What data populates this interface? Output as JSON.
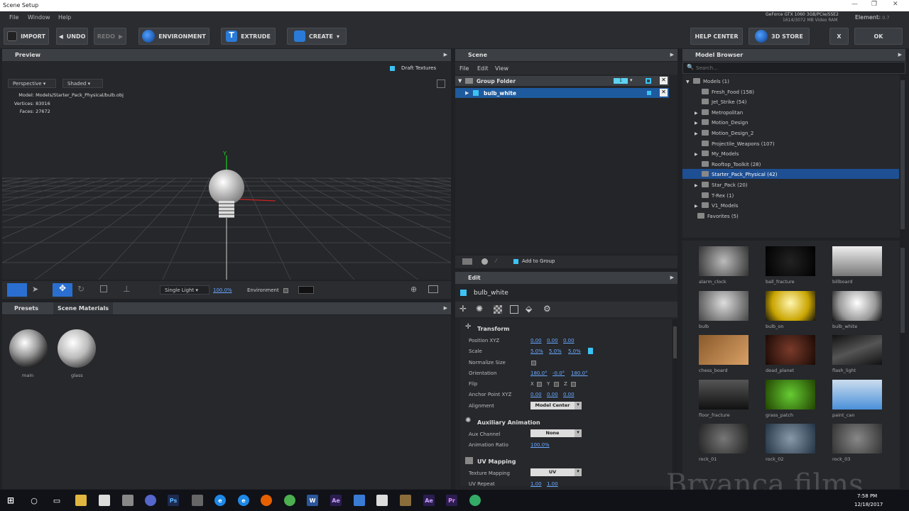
{
  "window": {
    "title": "Scene Setup",
    "app_name": "Element",
    "version": "2.0.7"
  },
  "menu": [
    "File",
    "Window",
    "Help"
  ],
  "gpu": {
    "line1": "GeForce GTX 1060 3GB/PCIe/SSE2",
    "line2": "1614/3072 MB Video RAM"
  },
  "toolbar": {
    "import": "IMPORT",
    "undo": "UNDO",
    "redo": "REDO",
    "environment": "ENVIRONMENT",
    "extrude": "EXTRUDE",
    "create": "CREATE",
    "help_center": "HELP CENTER",
    "store": "3D STORE",
    "x": "X",
    "ok": "OK"
  },
  "preview": {
    "title": "Preview",
    "draft_textures": "Draft Textures",
    "camera": "Perspective",
    "shading": "Shaded",
    "model_label": "Model:",
    "model": "Models/Starter_Pack_Physical/bulb.obj",
    "vertices_label": "Vertices:",
    "vertices": "83016",
    "faces_label": "Faces:",
    "faces": "27672",
    "axis_y": "Y"
  },
  "viewport_tools": {
    "light": "Single Light",
    "light_pct": "100.0%",
    "environment": "Environment"
  },
  "materials": {
    "tabs": [
      "Presets",
      "Scene Materials"
    ],
    "items": [
      "main",
      "glass"
    ]
  },
  "scene": {
    "title": "Scene",
    "menu": [
      "File",
      "Edit",
      "View"
    ],
    "group": "Group Folder",
    "group_badge": "1",
    "item": "bulb_white",
    "add_to_group": "Add to Group"
  },
  "edit": {
    "title": "Edit",
    "object": "bulb_white",
    "transform": {
      "title": "Transform",
      "position_label": "Position XYZ",
      "position": [
        "0.00",
        "0.00",
        "0.00"
      ],
      "scale_label": "Scale",
      "scale": [
        "5.0%",
        "5.0%",
        "5.0%"
      ],
      "normalize_label": "Normalize Size",
      "orientation_label": "Orientation",
      "orientation": [
        "180.0°",
        "-0.0°",
        "180.0°"
      ],
      "flip_label": "Flip",
      "flip": [
        "X",
        "Y",
        "Z"
      ],
      "anchor_label": "Anchor Point XYZ",
      "anchor": [
        "0.00",
        "0.00",
        "0.00"
      ],
      "alignment_label": "Alignment",
      "alignment": "Model Center"
    },
    "aux": {
      "title": "Auxiliary Animation",
      "channel_label": "Aux Channel",
      "channel": "None",
      "ratio_label": "Animation Ratio",
      "ratio": "100.0%"
    },
    "uv": {
      "title": "UV Mapping",
      "mapping_label": "Texture Mapping",
      "mapping": "UV",
      "repeat_label": "UV Repeat",
      "repeat": [
        "1.00",
        "1.00"
      ]
    }
  },
  "browser": {
    "title": "Model Browser",
    "search_placeholder": "Search...",
    "tree": [
      {
        "label": "Models (1)",
        "indent": 0,
        "arrow": "▼"
      },
      {
        "label": "Fresh_Food (158)",
        "indent": 2,
        "arrow": ""
      },
      {
        "label": "Jet_Strike (54)",
        "indent": 2,
        "arrow": ""
      },
      {
        "label": "Metropolitan",
        "indent": 2,
        "arrow": "▶"
      },
      {
        "label": "Motion_Design",
        "indent": 2,
        "arrow": "▶"
      },
      {
        "label": "Motion_Design_2",
        "indent": 2,
        "arrow": "▶"
      },
      {
        "label": "Projectile_Weapons (107)",
        "indent": 2,
        "arrow": ""
      },
      {
        "label": "My_Models",
        "indent": 2,
        "arrow": "▶"
      },
      {
        "label": "Rooftop_Toolkit (28)",
        "indent": 2,
        "arrow": ""
      },
      {
        "label": "Starter_Pack_Physical (42)",
        "indent": 2,
        "arrow": "",
        "selected": true
      },
      {
        "label": "Star_Pack (20)",
        "indent": 2,
        "arrow": "▶"
      },
      {
        "label": "T-Rex (1)",
        "indent": 2,
        "arrow": ""
      },
      {
        "label": "V1_Models",
        "indent": 2,
        "arrow": "▶"
      },
      {
        "label": "Favorites (5)",
        "indent": 1,
        "arrow": ""
      }
    ],
    "thumbs": [
      "alarm_clock",
      "ball_fracture",
      "billboard",
      "bulb",
      "bulb_on",
      "bulb_white",
      "chess_board",
      "dead_planet",
      "flash_light",
      "floor_fracture",
      "grass_patch",
      "paint_can",
      "rock_01",
      "rock_02",
      "rock_03"
    ]
  },
  "watermark": "Bryanca films",
  "taskbar": {
    "time": "7:58 PM",
    "date": "12/18/2017"
  }
}
